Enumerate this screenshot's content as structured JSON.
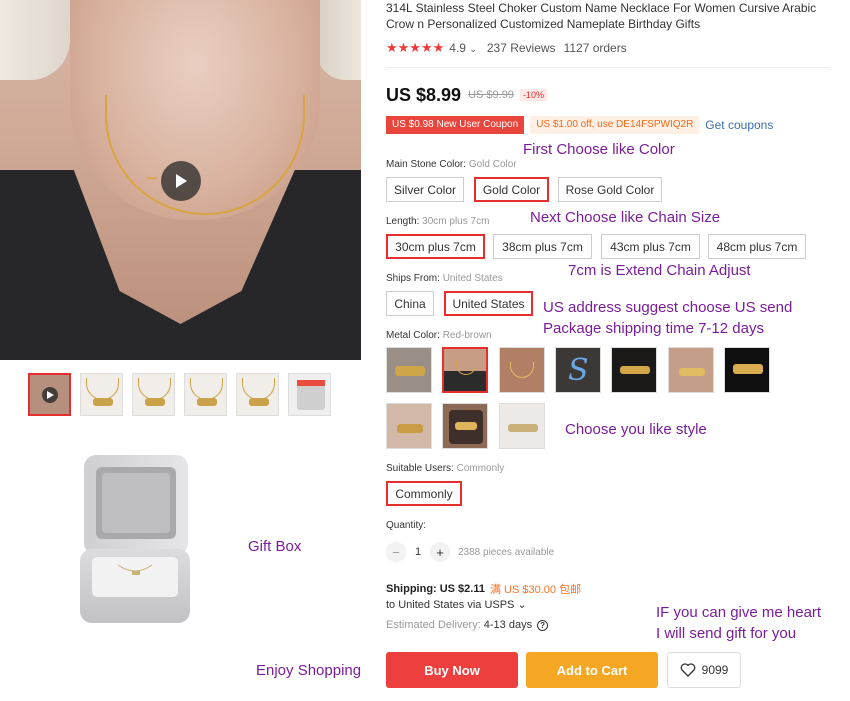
{
  "product": {
    "title": "314L Stainless Steel Choker Custom Name Necklace For Women Cursive Arabic Crow n Personalized Customized Nameplate Birthday Gifts",
    "rating": "4.9",
    "reviews": "237 Reviews",
    "orders": "1127 orders",
    "stars": "★★★★★"
  },
  "gallery": {
    "thumbnails": [
      "video",
      "chain-1",
      "chain-2",
      "chain-3",
      "chain-4",
      "gift-box"
    ]
  },
  "price": {
    "current": "US $8.99",
    "original": "US $9.99",
    "discount": "-10%"
  },
  "coupons": {
    "new_user": "US $0.98 New User Coupon",
    "store": "US $1.00 off, use DE14FSPWIQ2R",
    "get": "Get coupons"
  },
  "options": {
    "main_stone": {
      "label": "Main Stone Color:",
      "value": "Gold Color",
      "choices": [
        "Silver Color",
        "Gold Color",
        "Rose Gold Color"
      ]
    },
    "length": {
      "label": "Length:",
      "value": "30cm plus 7cm",
      "choices": [
        "30cm plus 7cm",
        "38cm plus 7cm",
        "43cm plus 7cm",
        "48cm plus 7cm"
      ]
    },
    "ships_from": {
      "label": "Ships From:",
      "value": "United States",
      "choices": [
        "China",
        "United States"
      ]
    },
    "metal_color": {
      "label": "Metal Color:",
      "value": "Red-brown"
    },
    "suitable_users": {
      "label": "Suitable Users:",
      "value": "Commonly",
      "choices": [
        "Commonly"
      ]
    }
  },
  "quantity": {
    "label": "Quantity:",
    "minus": "−",
    "plus": "+",
    "value": "1",
    "available": "2388 pieces available"
  },
  "shipping": {
    "label": "Shipping:",
    "cost": "US $2.11",
    "promo": "满 US $30.00 包邮",
    "to": "to United States via USPS ⌄",
    "delivery_label": "Estimated Delivery:",
    "delivery_days": "4-13 days"
  },
  "actions": {
    "buy_now": "Buy Now",
    "add_to_cart": "Add to Cart",
    "wishlist_count": "9099"
  },
  "annotations": {
    "first_choose": "First Choose like Color",
    "next_choose": "Next Choose like Chain Size",
    "extend_chain": "7cm is Extend Chain Adjust",
    "us_address": "US address suggest choose US send",
    "package_time": "Package shipping time 7-12 days",
    "choose_style": "Choose you like style",
    "gift_box": "Gift Box",
    "enjoy": "Enjoy Shopping",
    "heart_1": "IF you can give me heart",
    "heart_2": "I will send gift for you"
  },
  "colors": {
    "accent_red": "#e62e2e",
    "annotation_purple": "#7a1d9a",
    "buy_now": "#ee3f3f",
    "add_to_cart": "#f5a623",
    "link_blue": "#3a6db5"
  }
}
